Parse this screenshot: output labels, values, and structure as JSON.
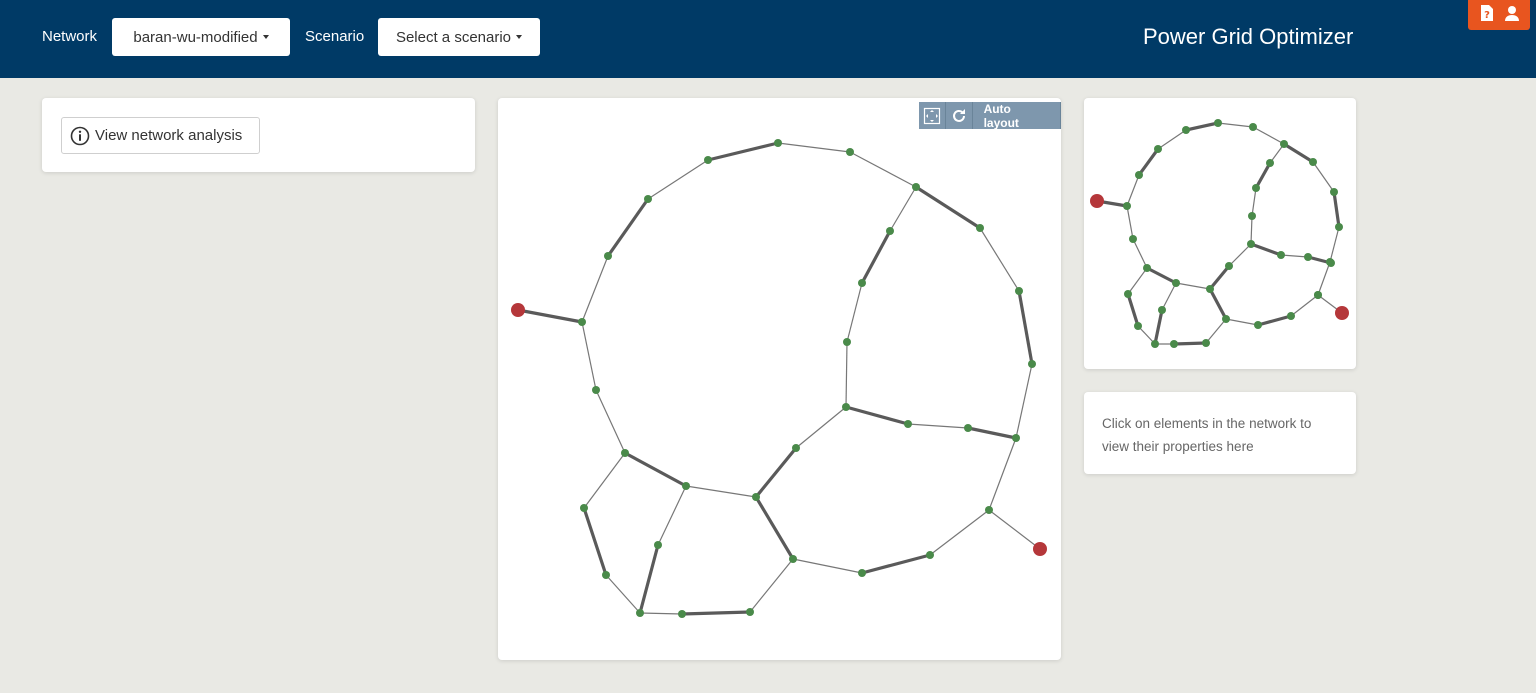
{
  "header": {
    "network_label": "Network",
    "network_value": "baran-wu-modified",
    "scenario_label": "Scenario",
    "scenario_value": "Select a scenario",
    "app_title": "Power Grid Optimizer",
    "icons": [
      "help-document-icon",
      "user-icon"
    ],
    "accent": "#e8551f",
    "bar_color": "#003a66"
  },
  "left_panel": {
    "analysis_button_label": "View network analysis",
    "analysis_icon": "info-circle-icon"
  },
  "graph_toolbar": {
    "fit_icon": "fit-view-icon",
    "refresh_icon": "refresh-icon",
    "auto_layout_label": "Auto layout"
  },
  "properties_panel": {
    "hint": "Click on elements in the network to view their properties here"
  },
  "colors": {
    "node": "#4a8a4a",
    "source_node": "#b5373a",
    "edge": "#666666",
    "background": "#e9e9e4"
  }
}
